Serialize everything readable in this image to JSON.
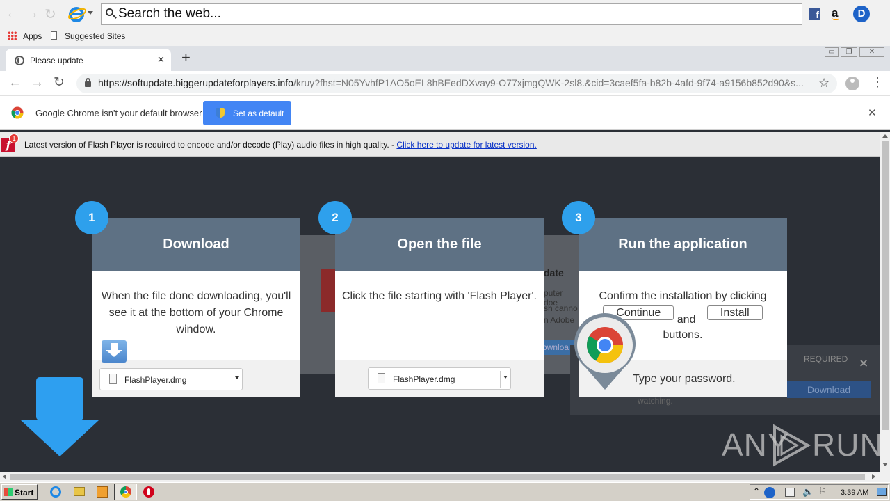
{
  "ie_toolbar": {
    "search_placeholder": "Search the web..."
  },
  "bookmarks": {
    "apps": "Apps",
    "suggested": "Suggested Sites"
  },
  "tab": {
    "title": "Please update",
    "close": "✕",
    "new_tab": "+"
  },
  "window_controls": {
    "min": "▭",
    "restore": "❐",
    "close": "✕"
  },
  "address": {
    "url_host": "https://softupdate.biggerupdateforplayers.info",
    "url_path": "/kruy?fhst=N05YvhfP1AO5oEL8hBEedDXvay9-O77xjmgQWK-2sl8.&cid=3caef5fa-b82b-4afd-9f74-a9156b852d90&s..."
  },
  "default_bar": {
    "message": "Google Chrome isn't your default browser",
    "button": "Set as default",
    "close": "✕"
  },
  "flash_bar": {
    "message": "Latest version of Flash Player is required to encode and/or decode (Play) audio files in high quality. - ",
    "link": "Click here to update for latest version.",
    "badge": "1"
  },
  "steps": [
    {
      "num": "1",
      "title": "Download",
      "body": "When the file done downloading, you'll see it at the bottom of your Chrome window.",
      "file": "FlashPlayer.dmg"
    },
    {
      "num": "2",
      "title": "Open the file",
      "body": "Click the file starting with 'Flash Player'.",
      "file": "FlashPlayer.dmg"
    },
    {
      "num": "3",
      "title": "Run the application",
      "body_pre": "Confirm the installation by clicking",
      "btn_continue": "Continue",
      "and": "and",
      "btn_install": "Install",
      "buttons": "buttons.",
      "footer": "Type your password."
    }
  ],
  "background_popup": {
    "update_fragment": "date",
    "line1": "puter doe",
    "line2": "sh canno",
    "line3": "n Adobe",
    "download_fragment": "ownloa",
    "required": "REQUIRED",
    "close": "✕",
    "download": "Download",
    "watching": "watching."
  },
  "watermark": {
    "left": "ANY",
    "right": "RUN"
  },
  "taskbar": {
    "start": "Start",
    "time": "3:39 AM"
  },
  "colors": {
    "page_bg": "#2b2f36",
    "card_header": "#5e7184",
    "step_circle": "#2ea0ec",
    "chrome_button": "#4285f4",
    "big_arrow": "#2e9ff0"
  }
}
